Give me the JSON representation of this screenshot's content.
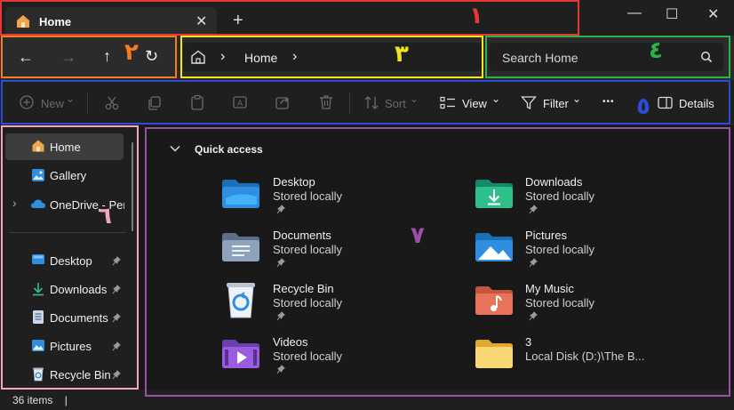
{
  "window": {
    "tab_title": "Home",
    "tab_close_glyph": "✕",
    "new_tab_glyph": "+",
    "minimize_glyph": "—",
    "maximize_glyph": "☐",
    "close_glyph": "✕"
  },
  "nav": {
    "back_glyph": "←",
    "forward_glyph": "→",
    "up_glyph": "↑",
    "refresh_glyph": "↻"
  },
  "address": {
    "sep_glyph": "›",
    "path": "Home"
  },
  "search": {
    "placeholder": "Search Home"
  },
  "toolbar": {
    "new_label": "New",
    "sort_label": "Sort",
    "view_label": "View",
    "filter_label": "Filter",
    "more_glyph": "•••",
    "details_label": "Details",
    "chevron_glyph": "⌄"
  },
  "sidebar": {
    "items": [
      {
        "label": "Home",
        "icon": "home-icon"
      },
      {
        "label": "Gallery",
        "icon": "gallery-icon"
      },
      {
        "label": "OneDrive - Perso",
        "icon": "cloud-icon"
      },
      {
        "label": "Desktop",
        "icon": "desktop-icon"
      },
      {
        "label": "Downloads",
        "icon": "download-icon"
      },
      {
        "label": "Documents",
        "icon": "document-icon"
      },
      {
        "label": "Pictures",
        "icon": "picture-icon"
      },
      {
        "label": "Recycle Bin",
        "icon": "recycle-bin-icon"
      }
    ],
    "expand_glyph": "›",
    "pin_glyph": "📌"
  },
  "main": {
    "section_title": "Quick access",
    "section_chevron": "⌄",
    "items": [
      {
        "name": "Desktop",
        "sub": "Stored locally"
      },
      {
        "name": "Downloads",
        "sub": "Stored locally"
      },
      {
        "name": "Documents",
        "sub": "Stored locally"
      },
      {
        "name": "Pictures",
        "sub": "Stored locally"
      },
      {
        "name": "Recycle Bin",
        "sub": "Stored locally"
      },
      {
        "name": "My Music",
        "sub": "Stored locally"
      },
      {
        "name": "Videos",
        "sub": "Stored locally"
      },
      {
        "name": "3",
        "sub": "Local Disk (D:)\\The B..."
      }
    ]
  },
  "status": {
    "count": "36 items",
    "divider": "|"
  },
  "annotations": {
    "n1": "١",
    "n2": "٢",
    "n3": "٣",
    "n4": "٤",
    "n5": "٥",
    "n6": "٦",
    "n7": "٧"
  },
  "colors": {
    "ann1": "#e53935",
    "ann2": "#f57c20",
    "ann3": "#f2e51c",
    "ann4": "#2bb34a",
    "ann5": "#2d4ad8",
    "ann6": "#f4a7b9",
    "ann7": "#9b4fa6",
    "folder_blue": "#2f8ee0",
    "accent": "#4cc2ff"
  }
}
